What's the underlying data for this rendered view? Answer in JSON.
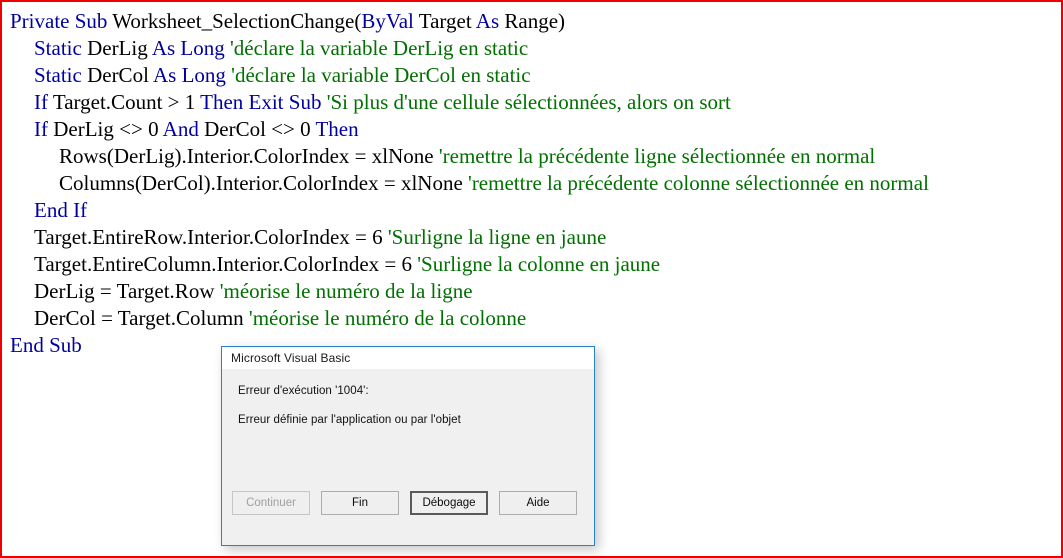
{
  "page": {
    "border_color": "#ee0000",
    "background": "#ffffff"
  },
  "editor": {
    "language": "VBA",
    "colors": {
      "keyword": "#0000a0",
      "identifier": "#000000",
      "comment": "#007000"
    },
    "lines": [
      {
        "indent": 0,
        "tokens": [
          {
            "t": "kw",
            "s": "Private Sub "
          },
          {
            "t": "id",
            "s": "Worksheet_SelectionChange"
          },
          {
            "t": "id",
            "s": "("
          },
          {
            "t": "kw",
            "s": "ByVal "
          },
          {
            "t": "id",
            "s": "Target "
          },
          {
            "t": "kw",
            "s": "As "
          },
          {
            "t": "id",
            "s": "Range)"
          }
        ]
      },
      {
        "indent": 1,
        "tokens": [
          {
            "t": "kw",
            "s": "Static "
          },
          {
            "t": "id",
            "s": "DerLig "
          },
          {
            "t": "kw",
            "s": "As Long "
          },
          {
            "t": "cmt",
            "s": "'déclare la variable DerLig en static"
          }
        ]
      },
      {
        "indent": 1,
        "tokens": [
          {
            "t": "kw",
            "s": "Static "
          },
          {
            "t": "id",
            "s": "DerCol "
          },
          {
            "t": "kw",
            "s": "As Long "
          },
          {
            "t": "cmt",
            "s": "'déclare la variable DerCol en static"
          }
        ]
      },
      {
        "indent": 1,
        "tokens": [
          {
            "t": "kw",
            "s": "If "
          },
          {
            "t": "id",
            "s": "Target.Count > 1 "
          },
          {
            "t": "kw",
            "s": "Then Exit Sub "
          },
          {
            "t": "cmt",
            "s": "'Si plus d'une cellule sélectionnées, alors on sort"
          }
        ]
      },
      {
        "indent": 1,
        "tokens": [
          {
            "t": "kw",
            "s": "If "
          },
          {
            "t": "id",
            "s": "DerLig <> 0 "
          },
          {
            "t": "kw",
            "s": "And "
          },
          {
            "t": "id",
            "s": "DerCol <> 0 "
          },
          {
            "t": "kw",
            "s": "Then"
          }
        ]
      },
      {
        "indent": 2,
        "tokens": [
          {
            "t": "id",
            "s": "Rows(DerLig).Interior.ColorIndex = xlNone "
          },
          {
            "t": "cmt",
            "s": "'remettre la précédente ligne sélectionnée en normal"
          }
        ]
      },
      {
        "indent": 2,
        "tokens": [
          {
            "t": "id",
            "s": "Columns(DerCol).Interior.ColorIndex = xlNone "
          },
          {
            "t": "cmt",
            "s": "'remettre la précédente colonne sélectionnée en normal"
          }
        ]
      },
      {
        "indent": 1,
        "tokens": [
          {
            "t": "kw",
            "s": "End If"
          }
        ]
      },
      {
        "indent": 1,
        "tokens": [
          {
            "t": "id",
            "s": "Target.EntireRow.Interior.ColorIndex = 6 "
          },
          {
            "t": "cmt",
            "s": "'Surligne la ligne en jaune"
          }
        ]
      },
      {
        "indent": 1,
        "tokens": [
          {
            "t": "id",
            "s": "Target.EntireColumn.Interior.ColorIndex = 6 "
          },
          {
            "t": "cmt",
            "s": "'Surligne la colonne en jaune"
          }
        ]
      },
      {
        "indent": 1,
        "tokens": [
          {
            "t": "id",
            "s": "DerLig = Target.Row "
          },
          {
            "t": "cmt",
            "s": "'méorise le numéro de la ligne"
          }
        ]
      },
      {
        "indent": 1,
        "tokens": [
          {
            "t": "id",
            "s": "DerCol = Target.Column "
          },
          {
            "t": "cmt",
            "s": "'méorise le numéro de la colonne"
          }
        ]
      },
      {
        "indent": 0,
        "tokens": [
          {
            "t": "kw",
            "s": "End Sub"
          }
        ]
      }
    ]
  },
  "dialog": {
    "title": "Microsoft Visual Basic",
    "message_line1": "Erreur d'exécution '1004':",
    "message_line2": "Erreur définie par l'application ou par l'objet",
    "border_color": "#2b7fd0",
    "buttons": [
      {
        "label": "Continuer",
        "state": "disabled"
      },
      {
        "label": "Fin",
        "state": "normal"
      },
      {
        "label": "Débogage",
        "state": "default"
      },
      {
        "label": "Aide",
        "state": "normal"
      }
    ]
  }
}
